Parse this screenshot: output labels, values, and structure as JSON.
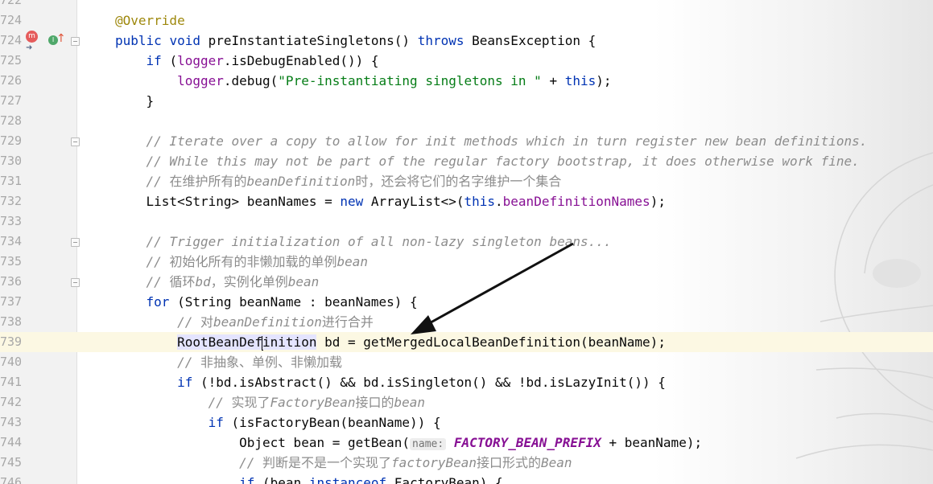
{
  "editor": {
    "lines": [
      {
        "num": "722",
        "tokens": []
      },
      {
        "num": "724",
        "tokens": [
          {
            "t": "@Override",
            "c": "ann"
          }
        ]
      },
      {
        "num": "724",
        "tokens": [
          {
            "t": "public ",
            "c": "kw"
          },
          {
            "t": "void ",
            "c": "kw"
          },
          {
            "t": "preInstantiateSingletons() ",
            "c": ""
          },
          {
            "t": "throws ",
            "c": "kw"
          },
          {
            "t": "BeansException {",
            "c": ""
          }
        ]
      },
      {
        "num": "725",
        "tokens": [
          {
            "t": "    ",
            "c": ""
          },
          {
            "t": "if ",
            "c": "kw"
          },
          {
            "t": "(",
            "c": ""
          },
          {
            "t": "logger",
            "c": "fld"
          },
          {
            "t": ".isDebugEnabled()) {",
            "c": ""
          }
        ]
      },
      {
        "num": "726",
        "tokens": [
          {
            "t": "        ",
            "c": ""
          },
          {
            "t": "logger",
            "c": "fld"
          },
          {
            "t": ".debug(",
            "c": ""
          },
          {
            "t": "\"Pre-instantiating singletons in \"",
            "c": "str"
          },
          {
            "t": " + ",
            "c": ""
          },
          {
            "t": "this",
            "c": "kw"
          },
          {
            "t": ");",
            "c": ""
          }
        ]
      },
      {
        "num": "727",
        "tokens": [
          {
            "t": "    }",
            "c": ""
          }
        ]
      },
      {
        "num": "728",
        "tokens": []
      },
      {
        "num": "729",
        "tokens": [
          {
            "t": "    // Iterate over a copy to allow for init methods which in turn register new bean definitions.",
            "c": "cm"
          }
        ]
      },
      {
        "num": "730",
        "tokens": [
          {
            "t": "    // While this may not be part of the regular factory bootstrap, it does otherwise work fine.",
            "c": "cm"
          }
        ]
      },
      {
        "num": "731",
        "tokens": [
          {
            "t": "    // ",
            "c": "cm"
          },
          {
            "t": "在维护所有的",
            "c": "cm-cn"
          },
          {
            "t": "beanDefinition",
            "c": "cm"
          },
          {
            "t": "时，还会将它们的名字维护一个集合",
            "c": "cm-cn"
          }
        ]
      },
      {
        "num": "732",
        "tokens": [
          {
            "t": "    List<String> beanNames = ",
            "c": ""
          },
          {
            "t": "new ",
            "c": "kw"
          },
          {
            "t": "ArrayList<>(",
            "c": ""
          },
          {
            "t": "this",
            "c": "kw"
          },
          {
            "t": ".",
            "c": ""
          },
          {
            "t": "beanDefinitionNames",
            "c": "fld"
          },
          {
            "t": ");",
            "c": ""
          }
        ]
      },
      {
        "num": "733",
        "tokens": []
      },
      {
        "num": "734",
        "tokens": [
          {
            "t": "    // Trigger initialization of all non-lazy singleton beans...",
            "c": "cm"
          }
        ]
      },
      {
        "num": "735",
        "tokens": [
          {
            "t": "    // ",
            "c": "cm"
          },
          {
            "t": "初始化所有的非懒加载的单例",
            "c": "cm-cn"
          },
          {
            "t": "bean",
            "c": "cm"
          }
        ]
      },
      {
        "num": "736",
        "tokens": [
          {
            "t": "    // ",
            "c": "cm"
          },
          {
            "t": "循环",
            "c": "cm-cn"
          },
          {
            "t": "bd",
            "c": "cm"
          },
          {
            "t": "，实例化单例",
            "c": "cm-cn"
          },
          {
            "t": "bean",
            "c": "cm"
          }
        ]
      },
      {
        "num": "737",
        "tokens": [
          {
            "t": "    ",
            "c": ""
          },
          {
            "t": "for ",
            "c": "kw"
          },
          {
            "t": "(String beanName : beanNames) {",
            "c": ""
          }
        ]
      },
      {
        "num": "738",
        "tokens": [
          {
            "t": "        // ",
            "c": "cm"
          },
          {
            "t": "对",
            "c": "cm-cn"
          },
          {
            "t": "beanDefinition",
            "c": "cm"
          },
          {
            "t": "进行合并",
            "c": "cm-cn"
          }
        ]
      },
      {
        "num": "739",
        "current": true,
        "tokens": [
          {
            "t": "        ",
            "c": ""
          },
          {
            "t": "RootBeanDef",
            "c": "sel"
          },
          {
            "t": "",
            "c": "caret"
          },
          {
            "t": "inition",
            "c": "sel"
          },
          {
            "t": " bd = getMergedLocalBeanDefinition(beanName);",
            "c": ""
          }
        ]
      },
      {
        "num": "740",
        "tokens": [
          {
            "t": "        // ",
            "c": "cm"
          },
          {
            "t": "非抽象、单例、非懒加载",
            "c": "cm-cn"
          }
        ]
      },
      {
        "num": "741",
        "tokens": [
          {
            "t": "        ",
            "c": ""
          },
          {
            "t": "if ",
            "c": "kw"
          },
          {
            "t": "(!bd.isAbstract() && bd.isSingleton() && !bd.isLazyInit()) {",
            "c": ""
          }
        ]
      },
      {
        "num": "742",
        "tokens": [
          {
            "t": "            // ",
            "c": "cm"
          },
          {
            "t": "实现了",
            "c": "cm-cn"
          },
          {
            "t": "FactoryBean",
            "c": "cm"
          },
          {
            "t": "接口的",
            "c": "cm-cn"
          },
          {
            "t": "bean",
            "c": "cm"
          }
        ]
      },
      {
        "num": "743",
        "tokens": [
          {
            "t": "            ",
            "c": ""
          },
          {
            "t": "if ",
            "c": "kw"
          },
          {
            "t": "(isFactoryBean(beanName)) {",
            "c": ""
          }
        ]
      },
      {
        "num": "744",
        "tokens": [
          {
            "t": "                Object bean = getBean(",
            "c": ""
          },
          {
            "t": "name:",
            "c": "hint"
          },
          {
            "t": " ",
            "c": ""
          },
          {
            "t": "FACTORY_BEAN_PREFIX",
            "c": "const"
          },
          {
            "t": " + beanName);",
            "c": ""
          }
        ]
      },
      {
        "num": "745",
        "tokens": [
          {
            "t": "                // ",
            "c": "cm"
          },
          {
            "t": "判断是不是一个实现了",
            "c": "cm-cn"
          },
          {
            "t": "factoryBean",
            "c": "cm"
          },
          {
            "t": "接口形式的",
            "c": "cm-cn"
          },
          {
            "t": "Bean",
            "c": "cm"
          }
        ]
      },
      {
        "num": "746",
        "tokens": [
          {
            "t": "                ",
            "c": ""
          },
          {
            "t": "if ",
            "c": "kw"
          },
          {
            "t": "(bean ",
            "c": ""
          },
          {
            "t": "instanceof ",
            "c": "kw"
          },
          {
            "t": "FactoryBean) {",
            "c": ""
          }
        ]
      }
    ],
    "gutter_icons": {
      "m_label": "m",
      "i_label": "I",
      "up_glyph": "↑",
      "arrow_glyph": "➜"
    }
  }
}
